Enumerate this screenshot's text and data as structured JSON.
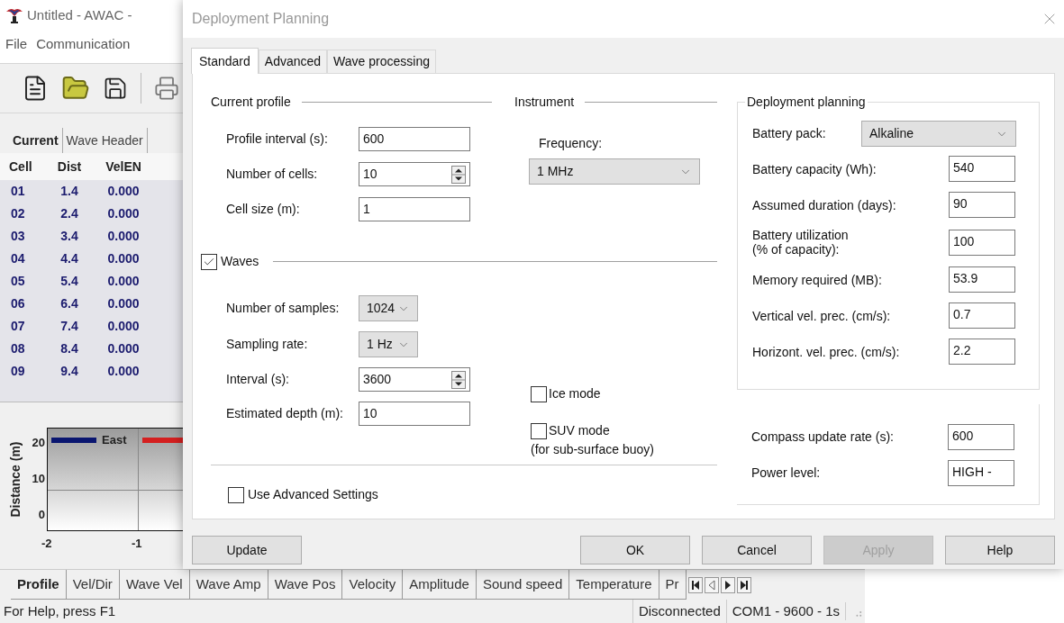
{
  "app": {
    "title": "Untitled - AWAC -",
    "menu": [
      {
        "label": "File"
      },
      {
        "label": "Communication"
      }
    ],
    "data_tabs": [
      {
        "label": "Current",
        "selected": true
      },
      {
        "label": "Wave Header",
        "selected": false
      }
    ],
    "table": {
      "columns": [
        "Cell",
        "Dist",
        "VelEN"
      ],
      "rows": [
        [
          "01",
          "1.4",
          "0.000"
        ],
        [
          "02",
          "2.4",
          "0.000"
        ],
        [
          "03",
          "3.4",
          "0.000"
        ],
        [
          "04",
          "4.4",
          "0.000"
        ],
        [
          "05",
          "5.4",
          "0.000"
        ],
        [
          "06",
          "6.4",
          "0.000"
        ],
        [
          "07",
          "7.4",
          "0.000"
        ],
        [
          "08",
          "8.4",
          "0.000"
        ],
        [
          "09",
          "9.4",
          "0.000"
        ]
      ]
    },
    "chart": {
      "ylabel": "Distance (m)",
      "yticks": [
        "20",
        "10",
        "0"
      ],
      "xticks": [
        "-2",
        "-1"
      ],
      "legend": [
        {
          "name": "East",
          "color": "#0a1670"
        },
        {
          "color": "#d42020"
        }
      ]
    },
    "view_tabs": [
      {
        "label": "Profile",
        "selected": true
      },
      {
        "label": "Vel/Dir",
        "selected": false
      },
      {
        "label": "Wave Vel",
        "selected": false
      },
      {
        "label": "Wave Amp",
        "selected": false
      },
      {
        "label": "Wave Pos",
        "selected": false
      },
      {
        "label": "Velocity",
        "selected": false
      },
      {
        "label": "Amplitude",
        "selected": false
      },
      {
        "label": "Sound speed",
        "selected": false
      },
      {
        "label": "Temperature",
        "selected": false
      },
      {
        "label": "Pr",
        "selected": false
      }
    ],
    "status_bar": {
      "message": "For Help, press F1",
      "panels": [
        "Disconnected",
        "COM1 - 9600 - 1s"
      ]
    }
  },
  "dialog": {
    "title": "Deployment Planning",
    "tabs": [
      {
        "label": "Standard",
        "selected": true
      },
      {
        "label": "Advanced",
        "selected": false
      },
      {
        "label": "Wave processing",
        "selected": false
      }
    ],
    "current_profile": {
      "title": "Current profile",
      "fields": [
        {
          "label": "Profile interval (s):",
          "value": "600",
          "kind": "text"
        },
        {
          "label": "Number of cells:",
          "value": "10",
          "kind": "spin"
        },
        {
          "label": "Cell size (m):",
          "value": "1",
          "kind": "text"
        }
      ]
    },
    "instrument": {
      "title": "Instrument",
      "label": "Frequency:",
      "value": "1 MHz"
    },
    "waves": {
      "label": "Waves",
      "checked": true,
      "fields": [
        {
          "label": "Number of samples:",
          "value": "1024",
          "kind": "select"
        },
        {
          "label": "Sampling rate:",
          "value": "1 Hz",
          "kind": "select"
        },
        {
          "label": "Interval (s):",
          "value": "3600",
          "kind": "spin"
        },
        {
          "label": "Estimated depth (m):",
          "value": "10",
          "kind": "text"
        }
      ]
    },
    "options": [
      {
        "label": "Ice mode",
        "checked": false
      },
      {
        "label": "SUV mode",
        "note": "(for sub-surface buoy)",
        "checked": false
      }
    ],
    "use_advanced": {
      "label": "Use Advanced Settings",
      "checked": false
    },
    "deployment_planning": {
      "title": "Deployment planning",
      "battery_pack": {
        "label": "Battery pack:",
        "value": "Alkaline"
      },
      "fields": [
        {
          "label": "Battery capacity (Wh):",
          "value": "540"
        },
        {
          "label": "Assumed duration (days):",
          "value": "90"
        },
        {
          "label": "Battery utilization\n(% of capacity):",
          "value": "100"
        },
        {
          "label": "Memory required (MB):",
          "value": "53.9"
        },
        {
          "label": "Vertical vel. prec. (cm/s):",
          "value": "0.7"
        },
        {
          "label": "Horizont. vel. prec. (cm/s):",
          "value": "2.2"
        }
      ]
    },
    "settings": [
      {
        "label": "Compass update rate (s):",
        "value": "600"
      },
      {
        "label": "Power level:",
        "value": "HIGH -"
      }
    ],
    "buttons": [
      {
        "label": "Update",
        "disabled": false
      },
      {
        "label": "OK",
        "disabled": false
      },
      {
        "label": "Cancel",
        "disabled": false
      },
      {
        "label": "Apply",
        "disabled": true
      },
      {
        "label": "Help",
        "disabled": false
      }
    ]
  }
}
